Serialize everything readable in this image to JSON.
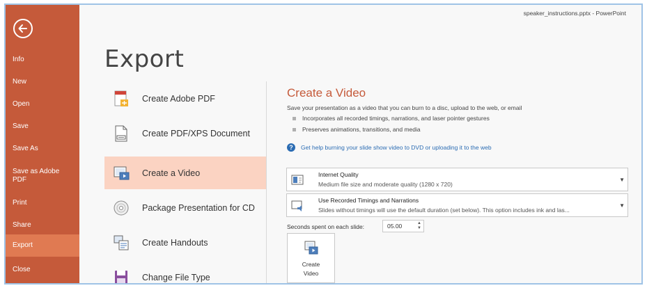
{
  "window_title": "speaker_instructions.pptx - PowerPoint",
  "sidebar": {
    "items": [
      {
        "label": "Info"
      },
      {
        "label": "New"
      },
      {
        "label": "Open"
      },
      {
        "label": "Save"
      },
      {
        "label": "Save As"
      },
      {
        "label": "Save as Adobe\nPDF"
      },
      {
        "label": "Print"
      },
      {
        "label": "Share"
      },
      {
        "label": "Export",
        "active": true
      },
      {
        "label": "Close"
      }
    ]
  },
  "page_title": "Export",
  "options": [
    {
      "label": "Create Adobe PDF",
      "icon": "adobe-pdf-icon"
    },
    {
      "label": "Create PDF/XPS Document",
      "icon": "pdf-xps-icon"
    },
    {
      "label": "Create a Video",
      "icon": "video-icon",
      "active": true
    },
    {
      "label": "Package Presentation for CD",
      "icon": "cd-icon"
    },
    {
      "label": "Create Handouts",
      "icon": "handouts-icon"
    },
    {
      "label": "Change File Type",
      "icon": "file-type-icon"
    }
  ],
  "panel": {
    "title": "Create a Video",
    "description": "Save your presentation as a video that you can burn to a disc, upload to the web, or email",
    "bullets": [
      "Incorporates all recorded timings, narrations, and laser pointer gestures",
      "Preserves animations, transitions, and media"
    ],
    "help_link": "Get help burning your slide show video to DVD or uploading it to the web",
    "quality_dropdown": {
      "title": "Internet Quality",
      "subtitle": "Medium file size and moderate quality (1280 x 720)"
    },
    "timings_dropdown": {
      "title": "Use Recorded Timings and Narrations",
      "subtitle": "Slides without timings will use the default duration (set below). This option includes ink and las..."
    },
    "seconds_label": "Seconds spent on each slide:",
    "seconds_value": "05.00",
    "create_button": {
      "line1": "Create",
      "line2": "Video"
    }
  },
  "colors": {
    "accent": "#c55a3a",
    "active_nav": "#e07a52",
    "active_option": "#fbd3c2",
    "link": "#2b6cb3"
  }
}
